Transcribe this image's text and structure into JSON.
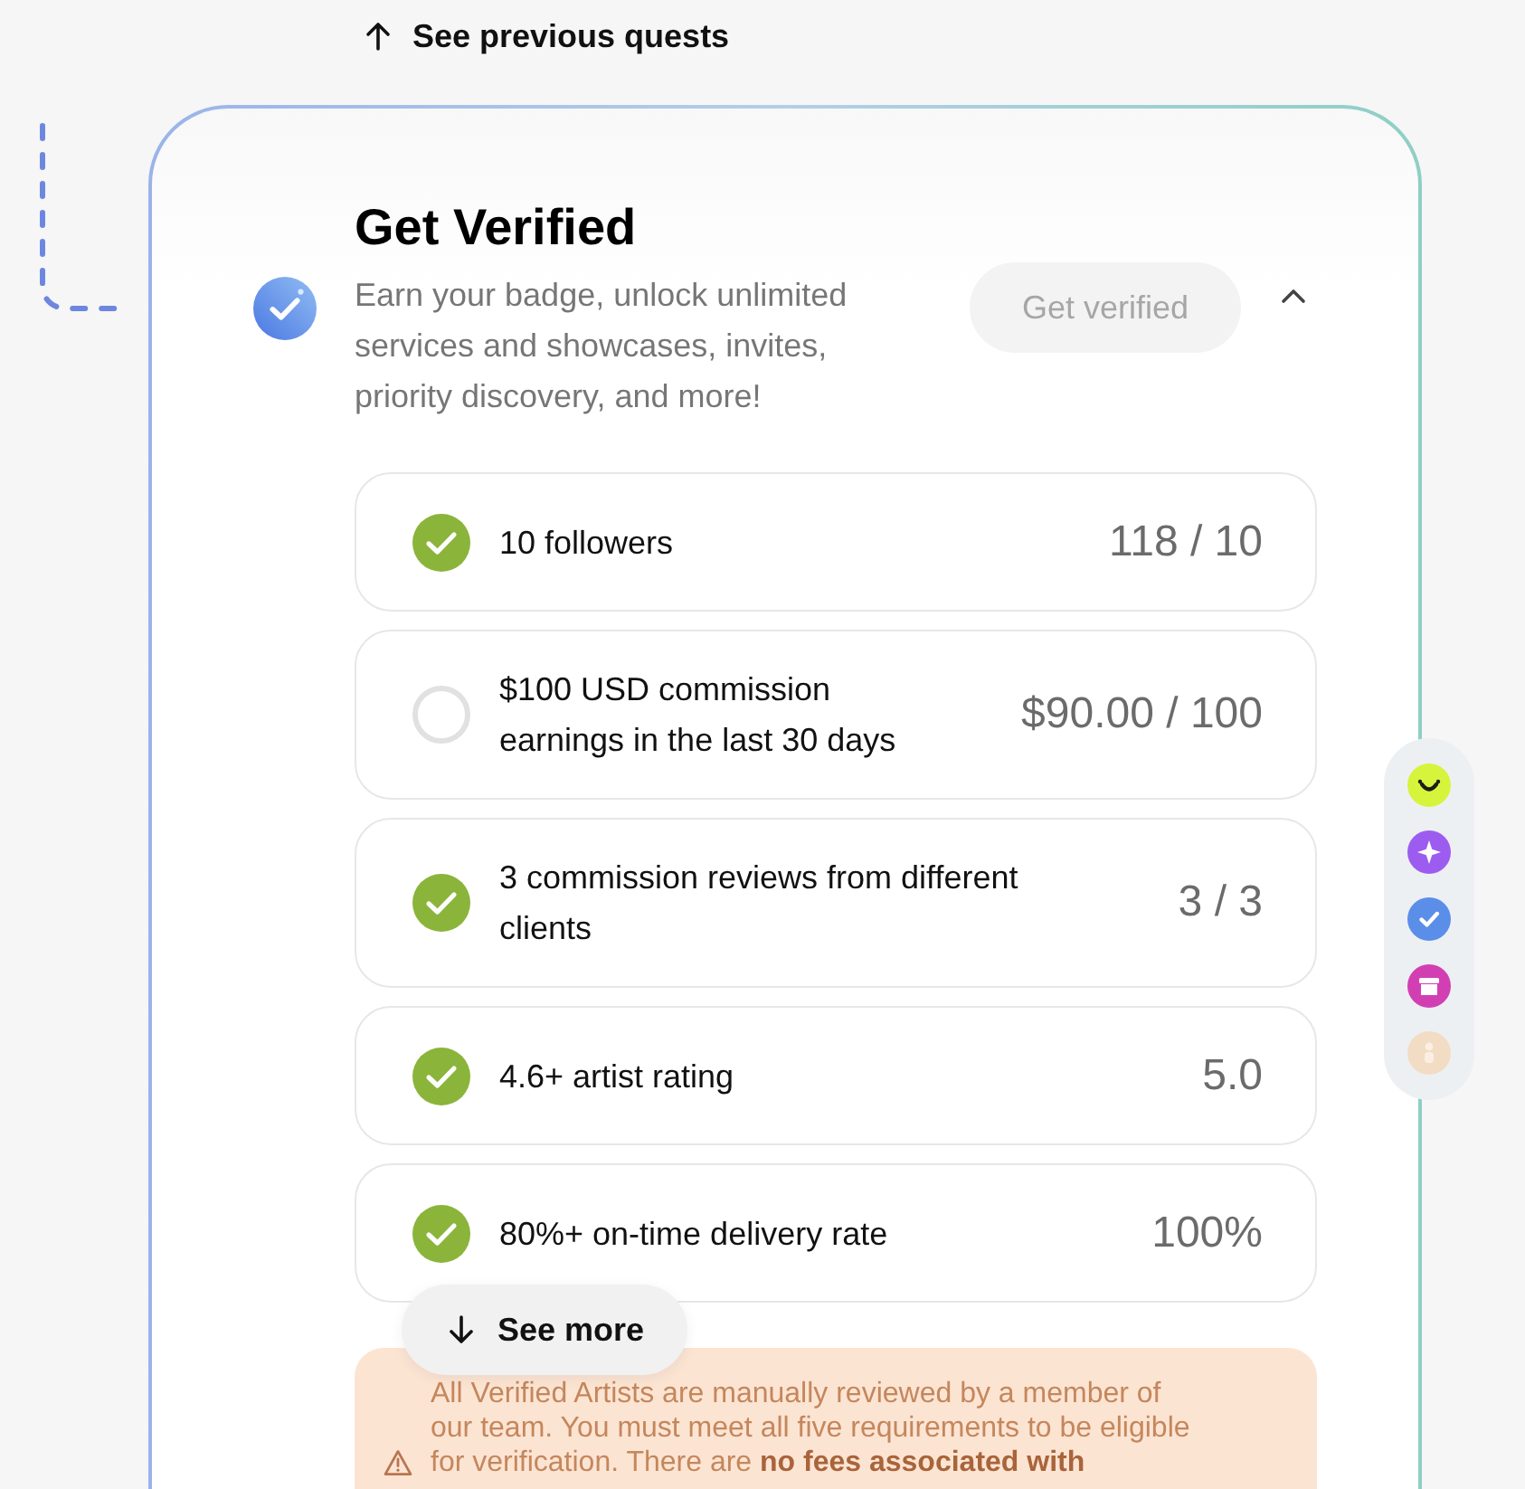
{
  "back_link": {
    "label": "See previous quests"
  },
  "verification": {
    "title": "Get Verified",
    "description": "Earn your badge, unlock unlimited services and showcases, invites, priority discovery, and more!",
    "button": {
      "label": "Get verified",
      "disabled": true
    },
    "expanded": true,
    "requirements": [
      {
        "label": "10 followers",
        "value": "118 / 10",
        "checked": true
      },
      {
        "label": "$100 USD commission earnings in the last 30 days",
        "value": "$90.00 / 100",
        "checked": false
      },
      {
        "label": "3 commission reviews from different clients",
        "value": "3 / 3",
        "checked": true
      },
      {
        "label": "4.6+ artist rating",
        "value": "5.0",
        "checked": true
      },
      {
        "label": "80%+ on-time delivery rate",
        "value": "100%",
        "checked": true
      }
    ],
    "see_more": {
      "label": "See more"
    },
    "notice": "All Verified Artists are manually reviewed by a member of our team. You must meet all five requirements to be eligible for verification. There are **no fees associated with**"
  },
  "rail": {
    "items": [
      {
        "color": "#d6f43c",
        "disabled": false
      },
      {
        "color": "#9d5cf0",
        "disabled": false
      },
      {
        "color": "#5b8ee8",
        "disabled": false
      },
      {
        "color": "#d23fb3",
        "disabled": false
      },
      {
        "color": "#f3dcc4",
        "disabled": true
      }
    ]
  }
}
